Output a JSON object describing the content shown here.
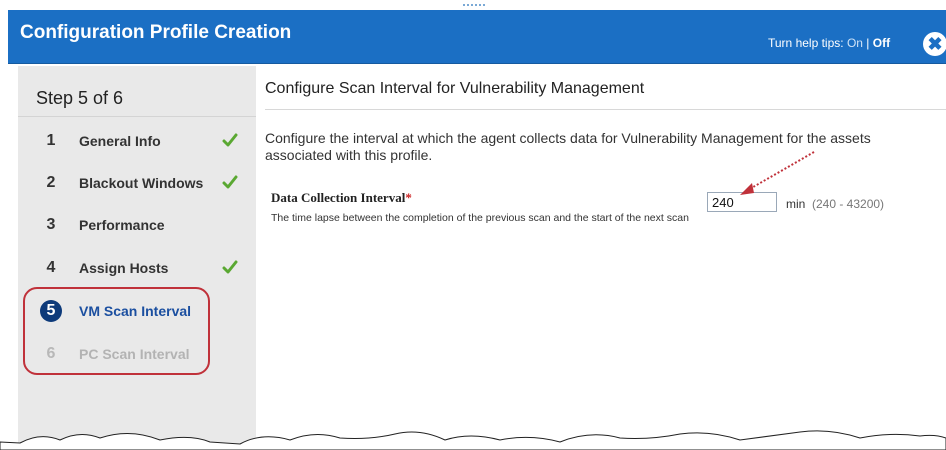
{
  "header": {
    "title": "Configuration Profile Creation",
    "help_prefix": "Turn help tips:",
    "help_on": "On",
    "help_separator": "|",
    "help_off": "Off",
    "close_symbol": "✖"
  },
  "sidebar": {
    "step_title": "Step 5 of 6",
    "items": [
      {
        "number": "1",
        "label": "General Info",
        "state": "complete"
      },
      {
        "number": "2",
        "label": "Blackout Windows",
        "state": "complete"
      },
      {
        "number": "3",
        "label": "Performance",
        "state": "default"
      },
      {
        "number": "4",
        "label": "Assign Hosts",
        "state": "complete"
      },
      {
        "number": "5",
        "label": "VM Scan Interval",
        "state": "active"
      },
      {
        "number": "6",
        "label": "PC Scan Interval",
        "state": "disabled"
      }
    ]
  },
  "main": {
    "title": "Configure Scan Interval for Vulnerability Management",
    "description": "Configure the interval at which the agent collects data for Vulnerability Management for the assets associated with this profile.",
    "field": {
      "label": "Data Collection Interval",
      "required_mark": "*",
      "help": "The time lapse between the completion of the previous scan and the start of the next scan",
      "value": "240",
      "unit": "min",
      "range": "(240 - 43200)"
    }
  },
  "colors": {
    "header_bg": "#1b6fc4",
    "active_step": "#0d3a7a",
    "check": "#5aa832",
    "highlight": "#c0313a",
    "sidebar_bg": "#e9e9e9"
  },
  "icons": {
    "check": "check-icon",
    "close": "close-icon",
    "annotation_arrow": "arrow-annotation"
  }
}
